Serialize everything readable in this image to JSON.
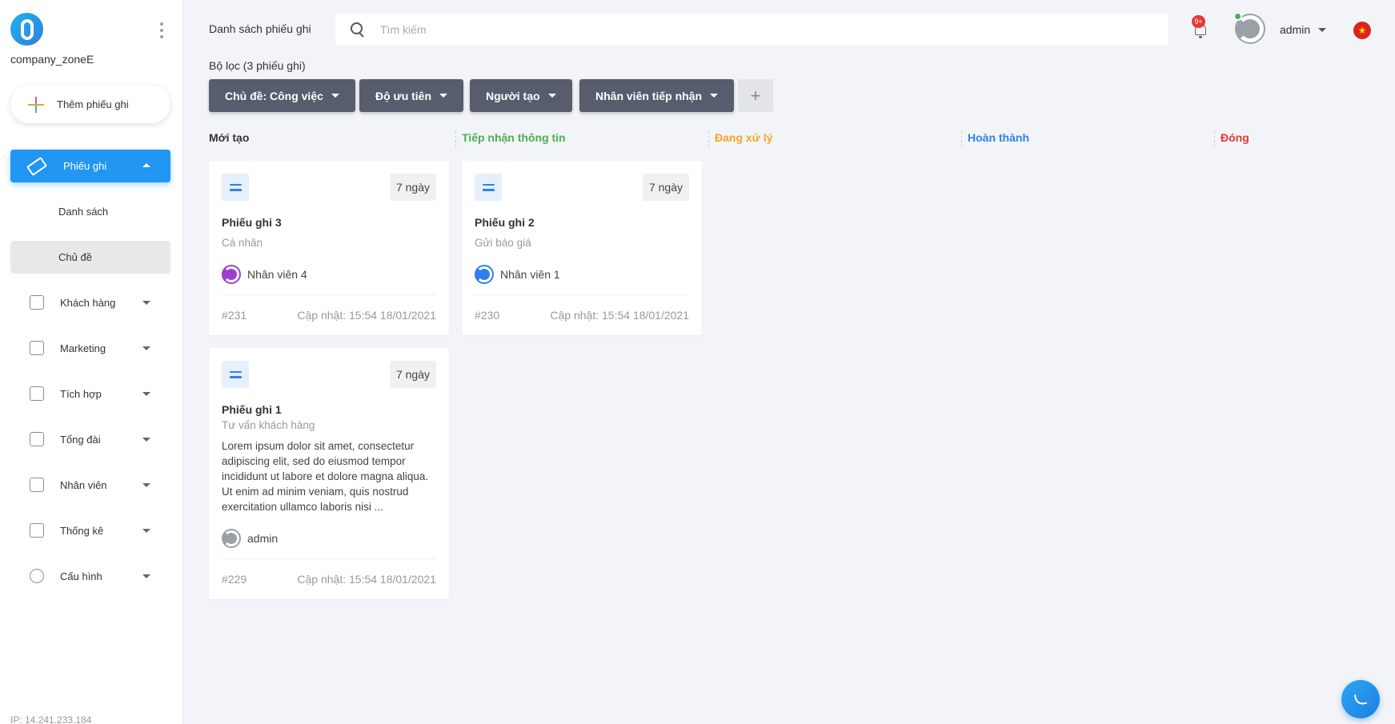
{
  "sidebar": {
    "company": "company_zoneE",
    "add_button": "Thêm phiếu ghi",
    "active_item": "Phiếu ghi",
    "sub_items": [
      "Danh sách",
      "Chủ đề"
    ],
    "items": [
      "Khách hàng",
      "Marketing",
      "Tích hợp",
      "Tổng đài",
      "Nhân viên",
      "Thống kê",
      "Cấu hình"
    ],
    "ip": "IP: 14.241.233.184"
  },
  "header": {
    "title": "Danh sách phiếu ghi",
    "search_placeholder": "Tìm kiếm",
    "notif_badge": "9+",
    "user": "admin",
    "flag": "★"
  },
  "filters": {
    "label": "Bộ lọc (3 phiếu ghi)",
    "chips": [
      "Chủ đề: Công việc",
      "Độ ưu tiên",
      "Người tạo",
      "Nhân viên tiếp nhận"
    ],
    "add": "+"
  },
  "columns": [
    {
      "title": "Mới tạo",
      "color": "#333333"
    },
    {
      "title": "Tiếp nhận thông tin",
      "color": "#4caf50"
    },
    {
      "title": "Đang xử lý",
      "color": "#f5a623"
    },
    {
      "title": "Hoàn thành",
      "color": "#2f80ed"
    },
    {
      "title": "Đóng",
      "color": "#e53935"
    }
  ],
  "cards": [
    {
      "age": "7 ngày",
      "title": "Phiếu ghi 3",
      "subtitle": "Cá nhân",
      "user": "Nhân viên 4",
      "id": "#231",
      "updated": "Cập nhật: 15:54 18/01/2021",
      "avatar_color": "#9c3fcf"
    },
    {
      "age": "7 ngày",
      "title": "Phiếu ghi 2",
      "subtitle": "Gửi báo giá",
      "user": "Nhân viên 1",
      "id": "#230",
      "updated": "Cập nhật: 15:54 18/01/2021",
      "avatar_color": "#2f80ed"
    },
    {
      "age": "7 ngày",
      "title": "Phiếu ghi 1",
      "subtitle": "Tư vấn khách hàng",
      "description": "Lorem ipsum dolor sit amet, consectetur adipiscing elit, sed do eiusmod tempor incididunt ut labore et dolore magna aliqua. Ut enim ad minim veniam, quis nostrud exercitation ullamco laboris nisi ...",
      "user": "admin",
      "id": "#229",
      "updated": "Cập nhật: 15:54 18/01/2021",
      "avatar_color": "#9aa0a8"
    }
  ]
}
